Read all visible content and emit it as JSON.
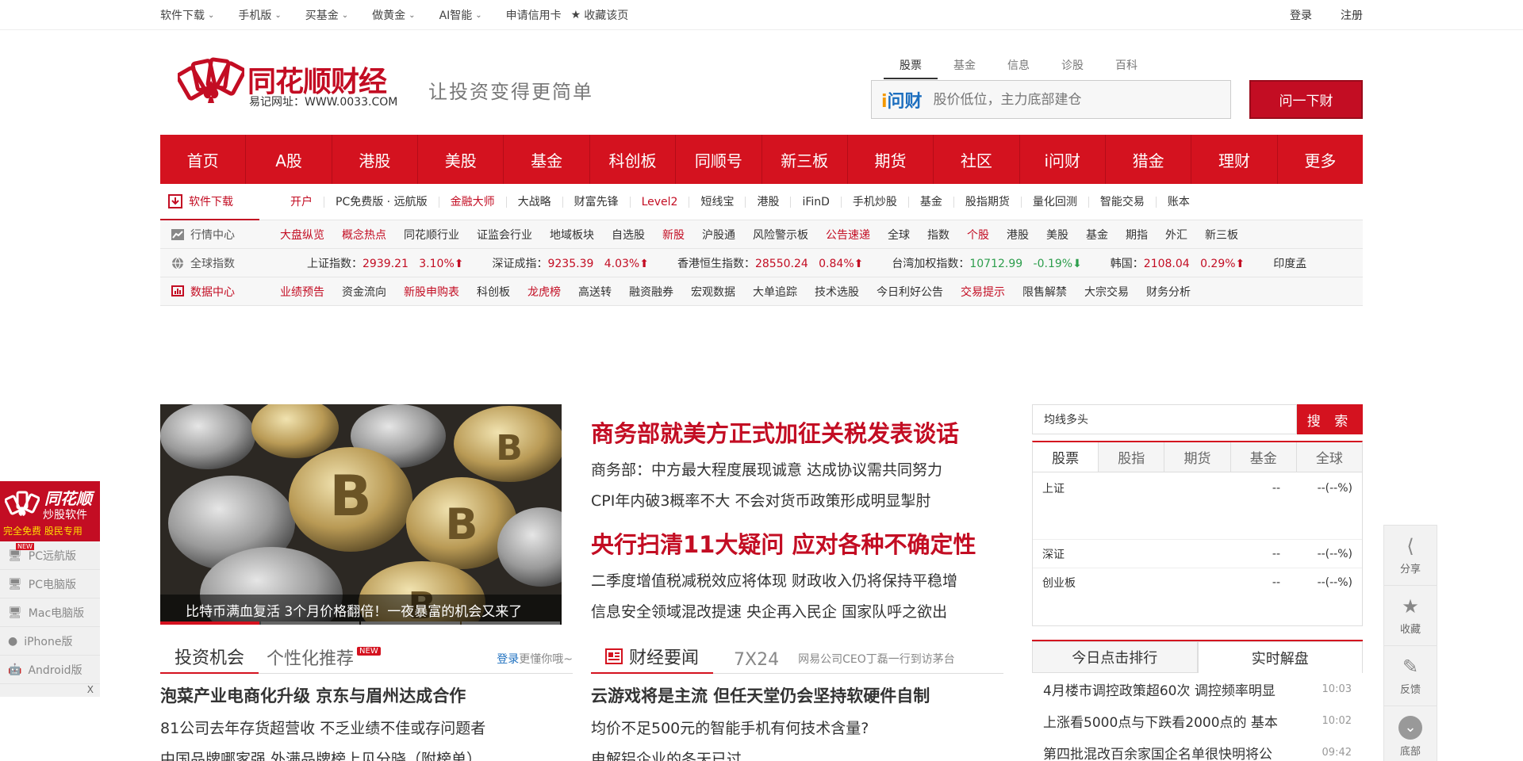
{
  "topbar": {
    "left": [
      "软件下载",
      "手机版",
      "买基金",
      "做黄金",
      "AI智能"
    ],
    "credit": "申请信用卡",
    "fav": "收藏该页",
    "login": "登录",
    "register": "注册"
  },
  "header": {
    "logo_name": "同花顺财经",
    "logo_url": "易记网址：WWW.0033.COM",
    "slogan": "让投资变得更简单",
    "search_tabs": [
      "股票",
      "基金",
      "信息",
      "诊股",
      "百科"
    ],
    "wencai_a": "i",
    "wencai_b": "问财",
    "search_placeholder": "股价低位，主力底部建仓",
    "ask_button": "问一下财"
  },
  "mainnav": [
    "首页",
    "A股",
    "港股",
    "美股",
    "基金",
    "科创板",
    "同顺号",
    "新三板",
    "期货",
    "社区",
    "i问财",
    "猎金",
    "理财",
    "更多"
  ],
  "software_row": {
    "label": "软件下载",
    "items": [
      {
        "t": "开户",
        "red": true
      },
      {
        "t": "PC免费版 · 远航版",
        "red": false
      },
      {
        "t": "金融大师",
        "red": true
      },
      {
        "t": "大战略",
        "red": false
      },
      {
        "t": "财富先锋",
        "red": false
      },
      {
        "t": "Level2",
        "red": true
      },
      {
        "t": "短线宝",
        "red": false
      },
      {
        "t": "港股",
        "red": false
      },
      {
        "t": "iFinD",
        "red": false
      },
      {
        "t": "手机炒股",
        "red": false
      },
      {
        "t": "基金",
        "red": false
      },
      {
        "t": "股指期货",
        "red": false
      },
      {
        "t": "量化回测",
        "red": false
      },
      {
        "t": "智能交易",
        "red": false
      },
      {
        "t": "账本",
        "red": false
      }
    ]
  },
  "market_row": {
    "label": "行情中心",
    "items": [
      {
        "t": "大盘纵览",
        "red": true
      },
      {
        "t": "概念热点",
        "red": true
      },
      {
        "t": "同花顺行业",
        "red": false
      },
      {
        "t": "证监会行业",
        "red": false
      },
      {
        "t": "地域板块",
        "red": false
      },
      {
        "t": "自选股",
        "red": false
      },
      {
        "t": "新股",
        "red": true
      },
      {
        "t": "沪股通",
        "red": false
      },
      {
        "t": "风险警示板",
        "red": false
      },
      {
        "t": "公告速递",
        "red": true
      },
      {
        "t": "全球",
        "red": false
      },
      {
        "t": "指数",
        "red": false
      },
      {
        "t": "个股",
        "red": true
      },
      {
        "t": "港股",
        "red": false
      },
      {
        "t": "美股",
        "red": false
      },
      {
        "t": "基金",
        "red": false
      },
      {
        "t": "期指",
        "red": false
      },
      {
        "t": "外汇",
        "red": false
      },
      {
        "t": "新三板",
        "red": false
      }
    ]
  },
  "global_row": {
    "label": "全球指数",
    "indices": [
      {
        "name": "上证指数：",
        "value": "2939.21",
        "pct": "3.10%",
        "up": true
      },
      {
        "name": "深证成指：",
        "value": "9235.39",
        "pct": "4.03%",
        "up": true
      },
      {
        "name": "香港恒生指数：",
        "value": "28550.24",
        "pct": "0.84%",
        "up": true
      },
      {
        "name": "台湾加权指数：",
        "value": "10712.99",
        "pct": "-0.19%",
        "up": false
      },
      {
        "name": "韩国：",
        "value": "2108.04",
        "pct": "0.29%",
        "up": true
      },
      {
        "name": "印度孟",
        "value": "",
        "pct": "",
        "up": true
      }
    ]
  },
  "data_row": {
    "label": "数据中心",
    "items": [
      {
        "t": "业绩预告",
        "red": true
      },
      {
        "t": "资金流向",
        "red": false
      },
      {
        "t": "新股申购表",
        "red": true
      },
      {
        "t": "科创板",
        "red": false
      },
      {
        "t": "龙虎榜",
        "red": true
      },
      {
        "t": "高送转",
        "red": false
      },
      {
        "t": "融资融券",
        "red": false
      },
      {
        "t": "宏观数据",
        "red": false
      },
      {
        "t": "大单追踪",
        "red": false
      },
      {
        "t": "技术选股",
        "red": false
      },
      {
        "t": "今日利好公告",
        "red": false
      },
      {
        "t": "交易提示",
        "red": true
      },
      {
        "t": "限售解禁",
        "red": false
      },
      {
        "t": "大宗交易",
        "red": false
      },
      {
        "t": "财务分析",
        "red": false
      }
    ]
  },
  "hero": {
    "caption": "比特币满血复活 3个月价格翻倍！一夜暴富的机会又来了"
  },
  "headlines": {
    "h1": "商务部就美方正式加征关税发表谈话",
    "l1": "商务部：中方最大程度展现诚意 达成协议需共同努力",
    "l2": "CPI年内破3概率不大 不会对货币政策形成明显掣肘",
    "h2": "央行扫清11大疑问 应对各种不确定性",
    "l3": "二季度增值税减税效应将体现 财政收入仍将保持平稳增",
    "l4": "信息安全领域混改提速 央企再入民企 国家队呼之欲出"
  },
  "right_search": {
    "value": "均线多头",
    "button": "搜 索",
    "tabs": [
      "股票",
      "股指",
      "期货",
      "基金",
      "全球"
    ],
    "rows": [
      {
        "name": "上证",
        "value": "--",
        "pct": "--(--%)"
      },
      {
        "name": "深证",
        "value": "--",
        "pct": "--(--%)"
      },
      {
        "name": "创业板",
        "value": "--",
        "pct": "--(--%)"
      }
    ]
  },
  "rank": {
    "tabs": [
      "今日点击排行",
      "实时解盘"
    ],
    "items": [
      {
        "t": "4月楼市调控政策超60次 调控频率明显",
        "time": "10:03"
      },
      {
        "t": "上涨看5000点与下跌看2000点的 基本",
        "time": "10:02"
      },
      {
        "t": "第四批混改百余家国企名单很快明将公",
        "time": "09:42"
      }
    ]
  },
  "invest": {
    "tab1": "投资机会",
    "tab2": "个性化推荐",
    "new": "NEW",
    "login": "登录",
    "more": "更懂你哦~",
    "big": "泡菜产业电商化升级 京东与眉州达成合作",
    "l1": "81公司去年存货超营收 不乏业绩不佳或存问题者",
    "l2": "中国品牌哪家强 外满品牌榜上见分晓（附榜单）"
  },
  "finance": {
    "title": "财经要闻",
    "tag": "7X24",
    "headline": "网易公司CEO丁磊一行到访茅台",
    "big": "云游戏将是主流 但任天堂仍会坚持软硬件自制",
    "l1": "均价不足500元的智能手机有何技术含量?",
    "l2": "电解铝企业的冬天已过"
  },
  "left_ad": {
    "t1": "同花顺",
    "t2": "炒股软件",
    "t3": "完全免费  股民专用",
    "items": [
      "PC远航版",
      "PC电脑版",
      "Mac电脑版",
      "iPhone版",
      "Android版"
    ],
    "new": "NEW",
    "close": "X"
  },
  "right_toolbar": [
    "分享",
    "收藏",
    "反馈",
    "底部"
  ]
}
